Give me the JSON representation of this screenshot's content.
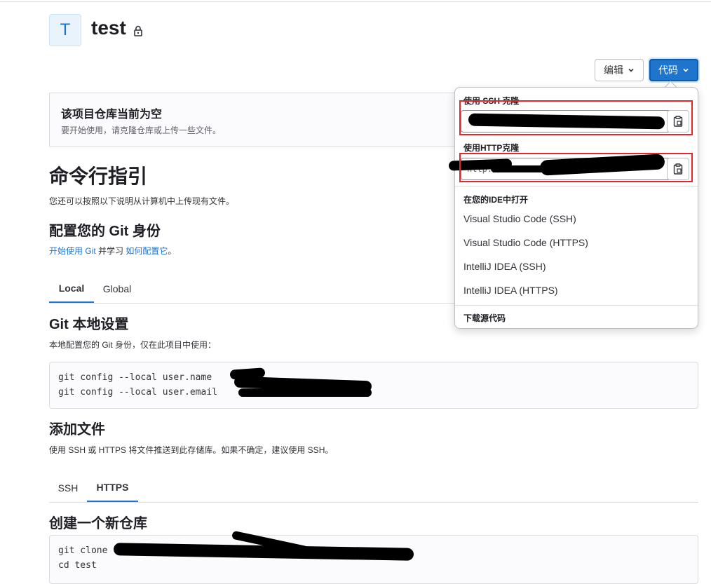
{
  "project": {
    "avatar_letter": "T",
    "name": "test"
  },
  "header_buttons": {
    "edit_label": "编辑",
    "code_label": "代码"
  },
  "empty_notice": {
    "title": "该项目仓库当前为空",
    "subtitle": "要开始使用，请克隆仓库或上传一些文件。"
  },
  "cli": {
    "heading": "命令行指引",
    "intro": "您还可以按照以下说明从计算机中上传现有文件。",
    "identity_heading": "配置您的 Git 身份",
    "identity_link1": "开始使用 Git",
    "identity_mid": " 并学习 ",
    "identity_link2": "如何配置它",
    "identity_end": "。",
    "scope_tabs": [
      "Local",
      "Global"
    ],
    "local_heading": "Git 本地设置",
    "local_desc": "本地配置您的 Git 身份，仅在此项目中使用：",
    "local_code": [
      "git config --local user.name ",
      "git config --local user.email "
    ],
    "add_files_heading": "添加文件",
    "add_files_desc": "使用 SSH 或 HTTPS 将文件推送到此存储库。如果不确定，建议使用 SSH。",
    "protocol_tabs": [
      "SSH",
      "HTTPS"
    ],
    "new_repo_heading": "创建一个新仓库",
    "new_repo_code": [
      "git clone ",
      "cd test"
    ]
  },
  "clone_dropdown": {
    "ssh_label": "使用 SSH 克隆",
    "http_label": "使用HTTP克隆",
    "http_value_visible": "http://      .92",
    "ide_heading": "在您的IDE中打开",
    "ide_items": [
      "Visual Studio Code (SSH)",
      "Visual Studio Code (HTTPS)",
      "IntelliJ IDEA (SSH)",
      "IntelliJ IDEA (HTTPS)"
    ],
    "download_label": "下载源代码"
  },
  "colors": {
    "accent": "#1f75cb",
    "highlight_red": "#e0282e",
    "redaction": "#000000"
  },
  "icons": [
    "lock-icon",
    "chevron-down-icon",
    "copy-to-clipboard-icon"
  ]
}
